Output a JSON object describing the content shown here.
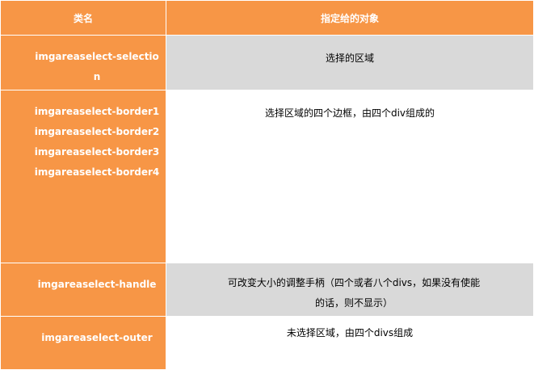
{
  "headers": [
    "类名",
    "指定给的对象"
  ],
  "rows": [
    {
      "keys": [
        "imgareaselect-selection"
      ],
      "desc": "选择的区域"
    },
    {
      "keys": [
        "imgareaselect-border1",
        "imgareaselect-border2",
        "imgareaselect-border3",
        "imgareaselect-border4"
      ],
      "desc": "选择区域的四个边框，由四个div组成的"
    },
    {
      "keys": [
        "imgareaselect-handle"
      ],
      "desc": "可改变大小的调整手柄（四个或者八个divs，如果没有使能的话，则不显示）"
    },
    {
      "keys": [
        "imgareaselect-outer"
      ],
      "desc": "未选择区域，由四个divs组成"
    }
  ]
}
